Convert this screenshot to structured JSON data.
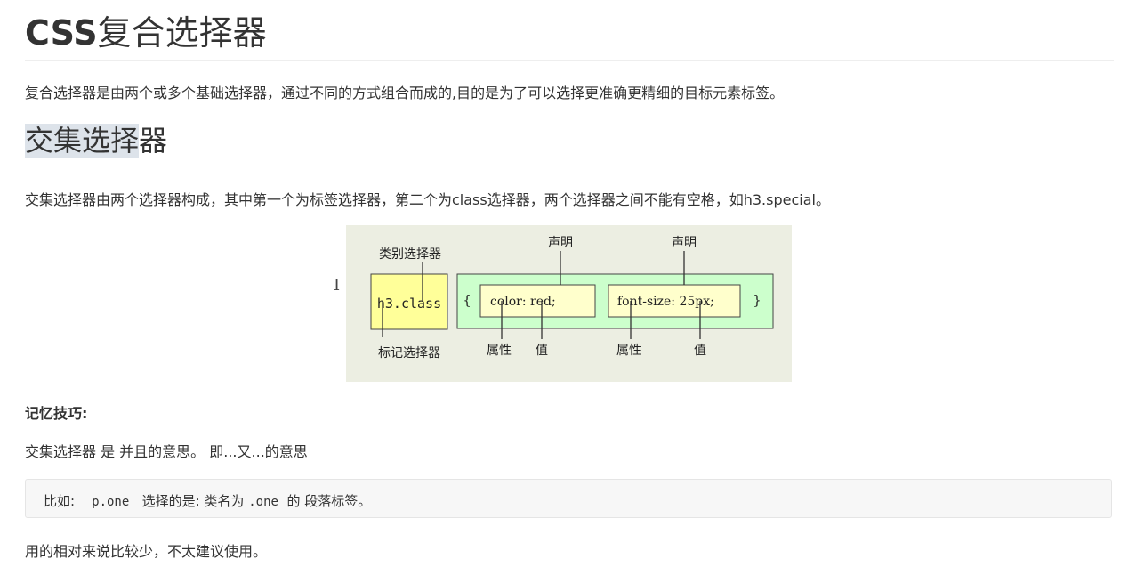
{
  "title": {
    "css": "CSS",
    "rest": "复合选择器"
  },
  "intro": "复合选择器是由两个或多个基础选择器，通过不同的方式组合而成的,目的是为了可以选择更准确更精细的目标元素标签。",
  "section": {
    "heading_highlight": "交集选择",
    "heading_rest": "器",
    "description": "交集选择器由两个选择器构成，其中第一个为标签选择器，第二个为class选择器，两个选择器之间不能有空格，如h3.special。"
  },
  "diagram": {
    "label_class_selector": "类别选择器",
    "label_tag_selector": "标记选择器",
    "selector_text": "h3.class",
    "open_brace": "{",
    "close_brace": "}",
    "decl1": "color: red;",
    "decl2": "font-size: 25px;",
    "label_declaration_1": "声明",
    "label_declaration_2": "声明",
    "label_property_1": "属性",
    "label_value_1": "值",
    "label_property_2": "属性",
    "label_value_2": "值",
    "colors": {
      "background": "#eceee2",
      "selector_box": "#ffff99",
      "rule_box": "#ccffcc",
      "decl_box": "#ffffcc",
      "stroke": "#444444"
    }
  },
  "cursor_glyph": "I",
  "memory_tip": {
    "title": "记忆技巧:",
    "text": "交集选择器 是 并且的意思。 即...又...的意思"
  },
  "code": {
    "prefix": "比如:",
    "selector": "p.one",
    "middle": "选择的是: 类名为",
    "classname": ".one",
    "suffix": "的 段落标签。"
  },
  "footer": "用的相对来说比较少，不太建议使用。"
}
